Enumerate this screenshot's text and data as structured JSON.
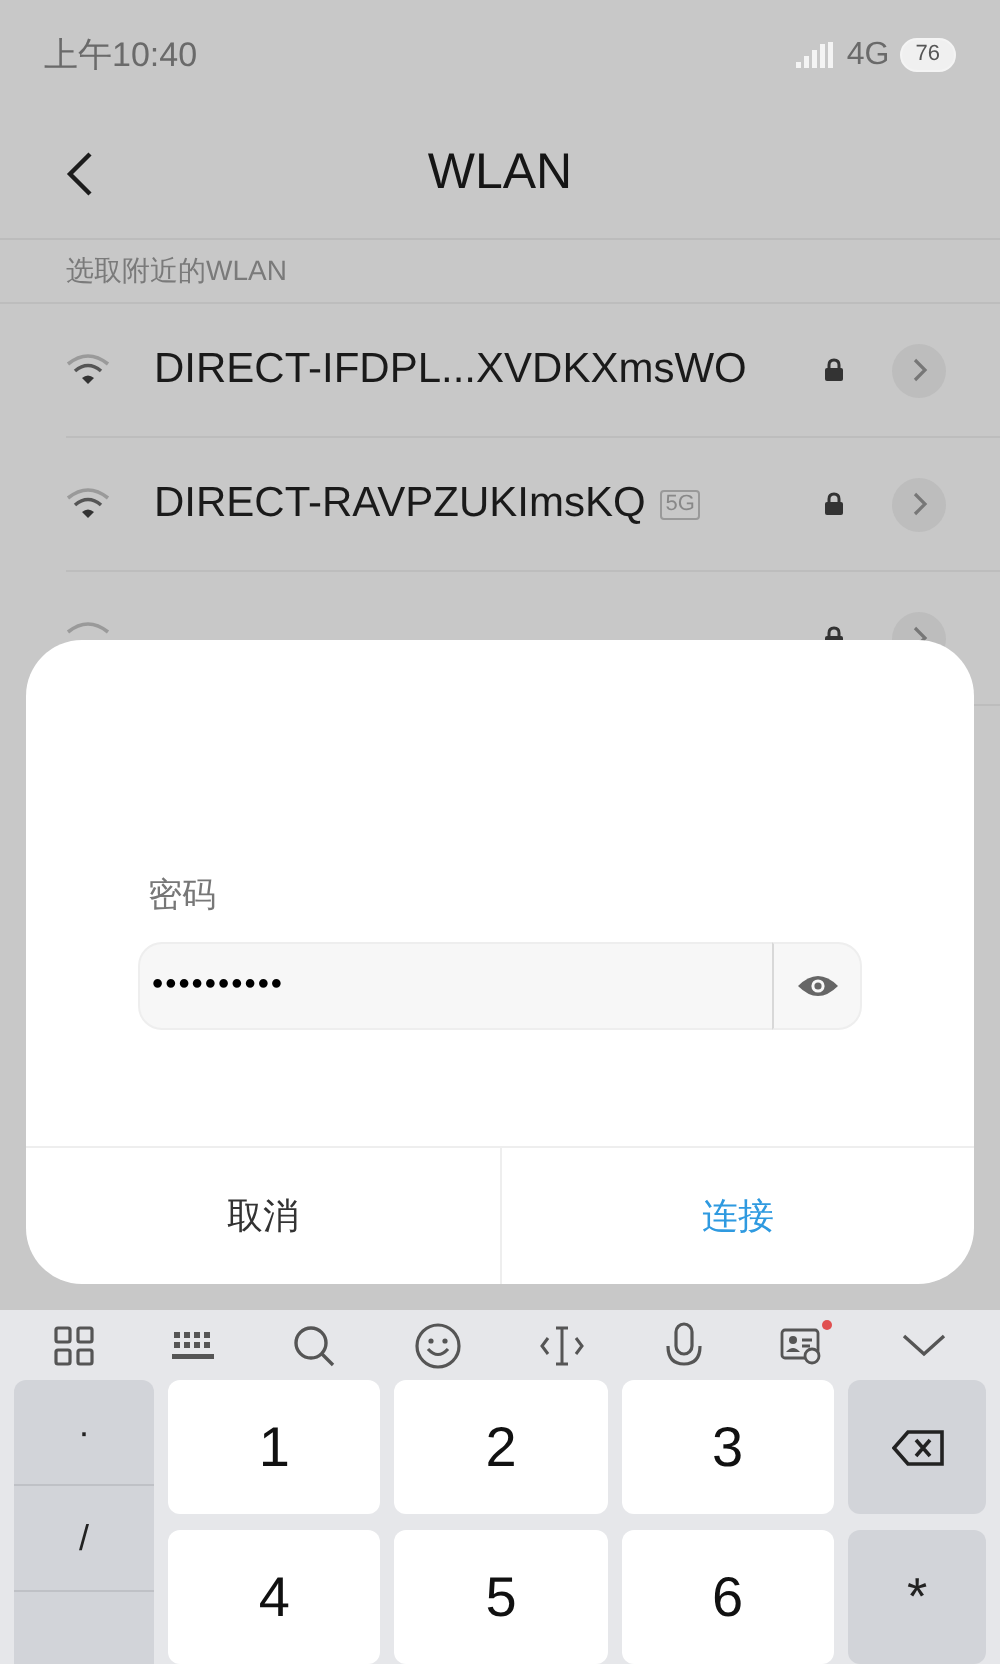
{
  "status_bar": {
    "time": "上午10:40",
    "network": "4G",
    "battery": "76"
  },
  "header": {
    "title": "WLAN"
  },
  "section_label": "选取附近的WLAN",
  "networks": [
    {
      "name": "DIRECT-IFDPL...XVDKXmsWO",
      "locked": true
    },
    {
      "name": "DIRECT-RAVPZUKImsKQ",
      "band": "5G",
      "locked": true
    },
    {
      "locked": true
    }
  ],
  "dialog": {
    "field_label": "密码",
    "password": "••••••••••",
    "buttons": [
      {
        "label": "取消",
        "primary": false
      },
      {
        "label": "连接",
        "primary": true
      }
    ]
  },
  "keyboard": {
    "side_keys": [
      "·",
      "/"
    ],
    "keys": [
      "1",
      "2",
      "3",
      "4",
      "5",
      "6"
    ],
    "right_keys": [
      {
        "kind": "backspace"
      },
      {
        "kind": "text",
        "label": "*"
      }
    ]
  }
}
